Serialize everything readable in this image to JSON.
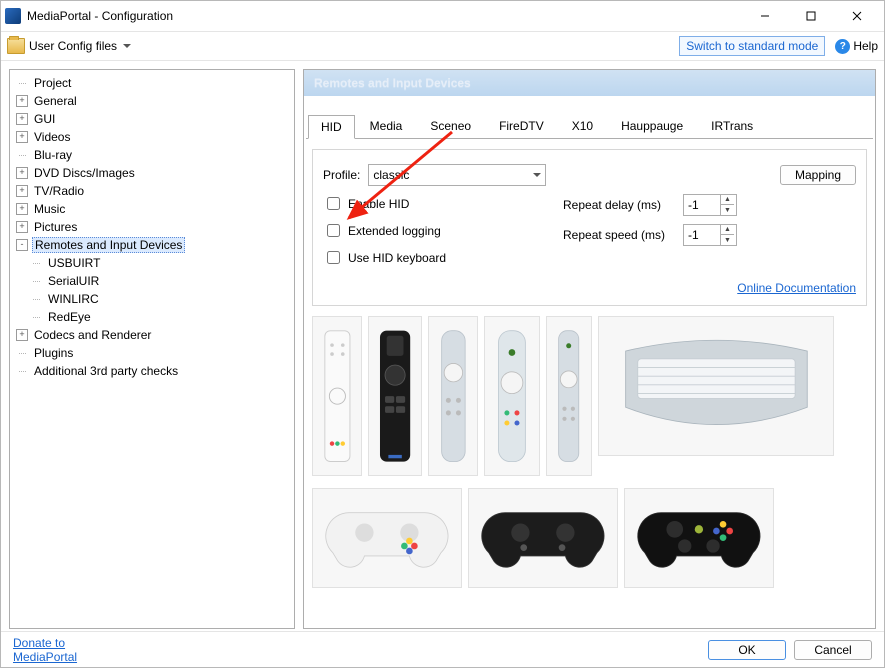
{
  "window": {
    "title": "MediaPortal - Configuration"
  },
  "toolbar": {
    "user_files": "User Config files",
    "mode_link": "Switch to standard mode",
    "help": "Help"
  },
  "tree": {
    "items": [
      {
        "label": "Project",
        "exp": ""
      },
      {
        "label": "General",
        "exp": "+"
      },
      {
        "label": "GUI",
        "exp": "+"
      },
      {
        "label": "Videos",
        "exp": "+"
      },
      {
        "label": "Blu-ray",
        "exp": ""
      },
      {
        "label": "DVD Discs/Images",
        "exp": "+"
      },
      {
        "label": "TV/Radio",
        "exp": "+"
      },
      {
        "label": "Music",
        "exp": "+"
      },
      {
        "label": "Pictures",
        "exp": "+"
      },
      {
        "label": "Remotes and Input Devices",
        "exp": "-",
        "selected": true,
        "children": [
          {
            "label": "USBUIRT"
          },
          {
            "label": "SerialUIR"
          },
          {
            "label": "WINLIRC"
          },
          {
            "label": "RedEye"
          }
        ]
      },
      {
        "label": "Codecs and Renderer",
        "exp": "+"
      },
      {
        "label": "Plugins",
        "exp": ""
      },
      {
        "label": "Additional 3rd party checks",
        "exp": ""
      }
    ]
  },
  "page": {
    "title": "Remotes and Input Devices",
    "tabs": [
      "HID",
      "Media",
      "Sceneo",
      "FireDTV",
      "X10",
      "Hauppauge",
      "IRTrans"
    ],
    "active_tab": 0,
    "profile_label": "Profile:",
    "profile_value": "classic",
    "mapping_btn": "Mapping",
    "checkboxes": {
      "enable_hid": "Enable HID",
      "extended_logging": "Extended logging",
      "use_hid_keyboard": "Use HID keyboard"
    },
    "repeat_delay_label": "Repeat delay (ms)",
    "repeat_delay_value": "-1",
    "repeat_speed_label": "Repeat speed (ms)",
    "repeat_speed_value": "-1",
    "docs_link": "Online Documentation"
  },
  "footer": {
    "donate": "Donate to MediaPortal",
    "ok": "OK",
    "cancel": "Cancel"
  }
}
